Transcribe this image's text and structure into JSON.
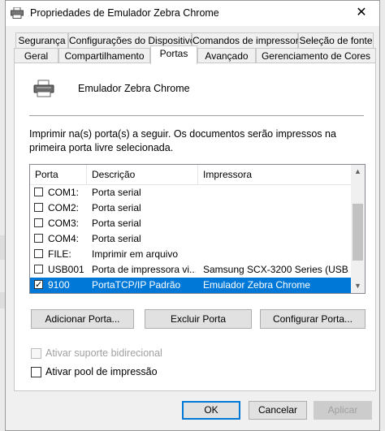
{
  "window": {
    "title": "Propriedades de Emulador Zebra Chrome",
    "close_glyph": "✕"
  },
  "tabs_row1": [
    {
      "label": "Segurança"
    },
    {
      "label": "Configurações do Dispositivo"
    },
    {
      "label": "Comandos de impressora"
    },
    {
      "label": "Seleção de fonte"
    }
  ],
  "tabs_row2": [
    {
      "label": "Geral"
    },
    {
      "label": "Compartilhamento"
    },
    {
      "label": "Portas",
      "active": true
    },
    {
      "label": "Avançado"
    },
    {
      "label": "Gerenciamento de Cores"
    }
  ],
  "printer": {
    "name": "Emulador Zebra Chrome",
    "icon": "printer-icon"
  },
  "description": "Imprimir na(s) porta(s) a seguir. Os documentos serão impressos na primeira porta livre selecionada.",
  "ports_table": {
    "headers": [
      "Porta",
      "Descrição",
      "Impressora"
    ],
    "rows": [
      {
        "checked": false,
        "port": "COM1:",
        "description": "Porta serial",
        "printer": ""
      },
      {
        "checked": false,
        "port": "COM2:",
        "description": "Porta serial",
        "printer": ""
      },
      {
        "checked": false,
        "port": "COM3:",
        "description": "Porta serial",
        "printer": ""
      },
      {
        "checked": false,
        "port": "COM4:",
        "description": "Porta serial",
        "printer": ""
      },
      {
        "checked": false,
        "port": "FILE:",
        "description": "Imprimir em arquivo",
        "printer": ""
      },
      {
        "checked": false,
        "port": "USB001",
        "description": "Porta de impressora vi...",
        "printer": "Samsung SCX-3200 Series (USB..."
      },
      {
        "checked": true,
        "port": "9100",
        "description": "PortaTCP/IP Padrão",
        "printer": "Emulador Zebra Chrome",
        "selected": true
      }
    ]
  },
  "buttons": {
    "add_port": "Adicionar Porta...",
    "delete_port": "Excluir Porta",
    "configure_port": "Configurar Porta..."
  },
  "options": {
    "bidirectional": {
      "label": "Ativar suporte bidirecional",
      "checked": false,
      "enabled": false
    },
    "pool": {
      "label": "Ativar pool de impressão",
      "checked": false,
      "enabled": true
    }
  },
  "footer": {
    "ok": "OK",
    "cancel": "Cancelar",
    "apply": "Aplicar"
  },
  "colors": {
    "selection": "#0078d7",
    "dialog_bg": "#f0f0f0"
  }
}
